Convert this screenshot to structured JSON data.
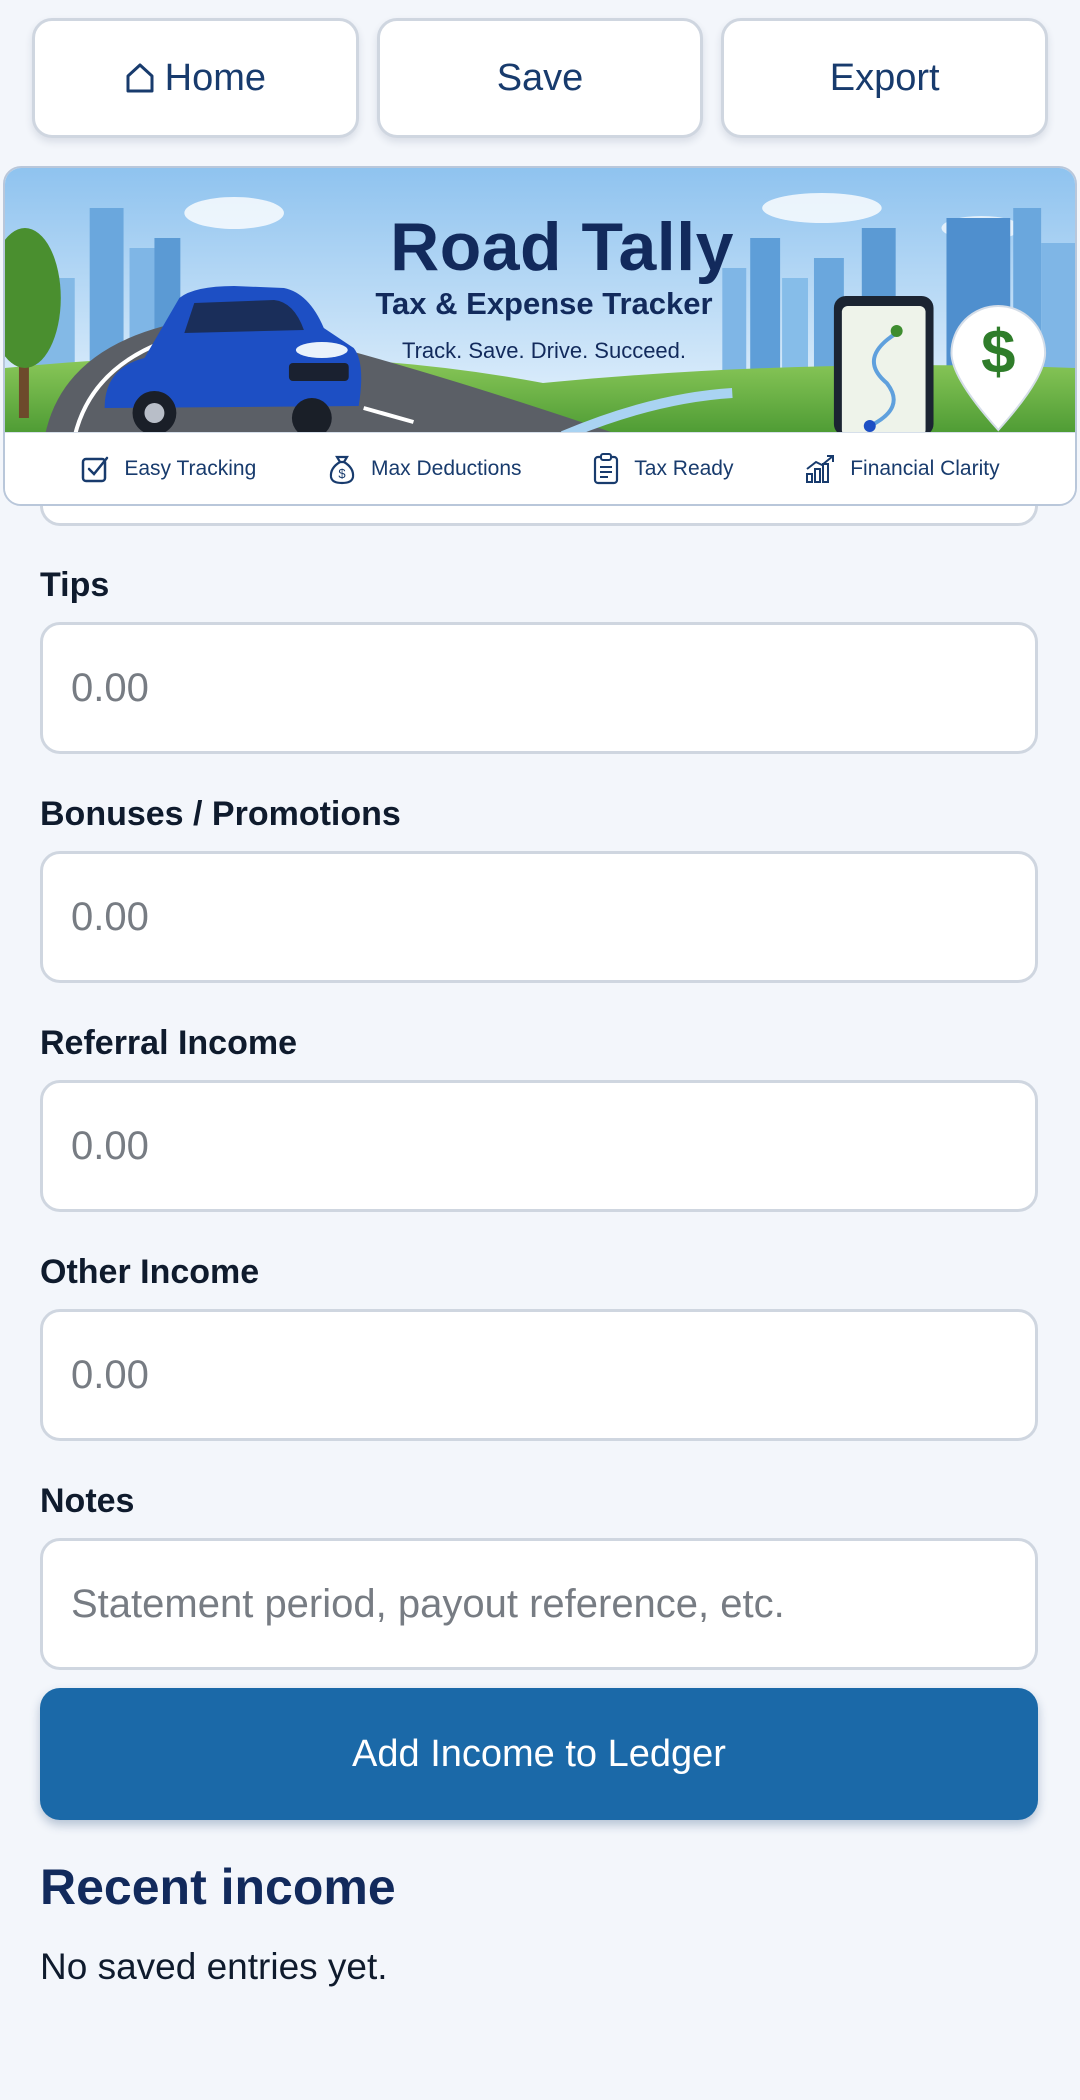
{
  "nav": {
    "home_label": "Home",
    "save_label": "Save",
    "export_label": "Export",
    "home_icon": "home-icon"
  },
  "banner": {
    "title": "Road Tally",
    "subtitle": "Tax & Expense Tracker",
    "tagline": "Track. Save. Drive. Succeed.",
    "features": [
      {
        "label": "Easy Tracking",
        "icon": "checkbox-icon"
      },
      {
        "label": "Max Deductions",
        "icon": "money-bag-icon"
      },
      {
        "label": "Tax Ready",
        "icon": "clipboard-icon"
      },
      {
        "label": "Financial Clarity",
        "icon": "growth-chart-icon"
      }
    ],
    "dollar_symbol": "$"
  },
  "form": {
    "tips": {
      "label": "Tips",
      "placeholder": "0.00",
      "value": ""
    },
    "bonuses": {
      "label": "Bonuses / Promotions",
      "placeholder": "0.00",
      "value": ""
    },
    "referral": {
      "label": "Referral Income",
      "placeholder": "0.00",
      "value": ""
    },
    "other": {
      "label": "Other Income",
      "placeholder": "0.00",
      "value": ""
    },
    "notes": {
      "label": "Notes",
      "placeholder": "Statement period, payout reference, etc.",
      "value": ""
    },
    "submit_label": "Add Income to Ledger"
  },
  "recent": {
    "heading": "Recent income",
    "empty_text": "No saved entries yet."
  },
  "colors": {
    "accent": "#1b69a8",
    "heading": "#122a5c",
    "background": "#f3f6fb"
  }
}
